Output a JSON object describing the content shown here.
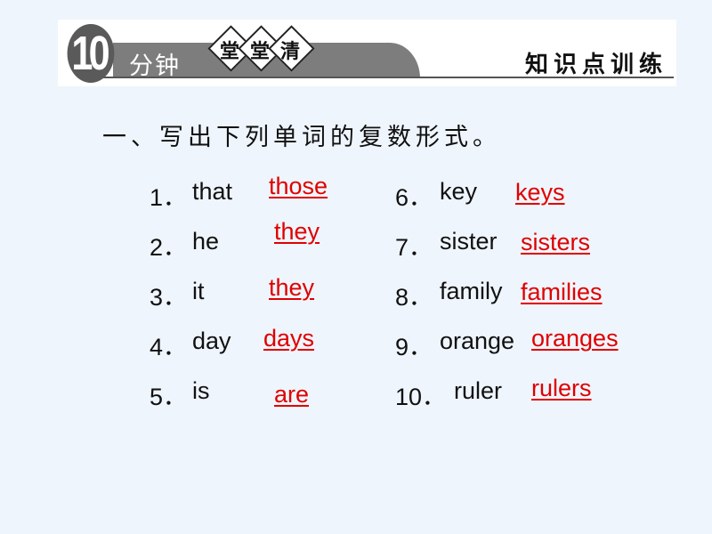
{
  "header": {
    "badge_number": "10",
    "minutes_label": "分钟",
    "title_chars": [
      "堂",
      "堂",
      "清"
    ],
    "section_label": "知识点训练"
  },
  "exercise": {
    "instruction": "一、写出下列单词的复数形式。",
    "answer_color": "#e00000",
    "items": [
      {
        "num": "1．",
        "word": "that",
        "answer": "those"
      },
      {
        "num": "2．",
        "word": "he",
        "answer": "they"
      },
      {
        "num": "3．",
        "word": "it",
        "answer": "they"
      },
      {
        "num": "4．",
        "word": "day",
        "answer": "days"
      },
      {
        "num": "5．",
        "word": "is",
        "answer": "are"
      },
      {
        "num": "6．",
        "word": "key",
        "answer": "keys"
      },
      {
        "num": "7．",
        "word": "sister",
        "answer": "sisters"
      },
      {
        "num": "8．",
        "word": "family",
        "answer": "families"
      },
      {
        "num": "9．",
        "word": "orange",
        "answer": "oranges"
      },
      {
        "num": "10．",
        "word": "ruler",
        "answer": "rulers"
      }
    ]
  }
}
